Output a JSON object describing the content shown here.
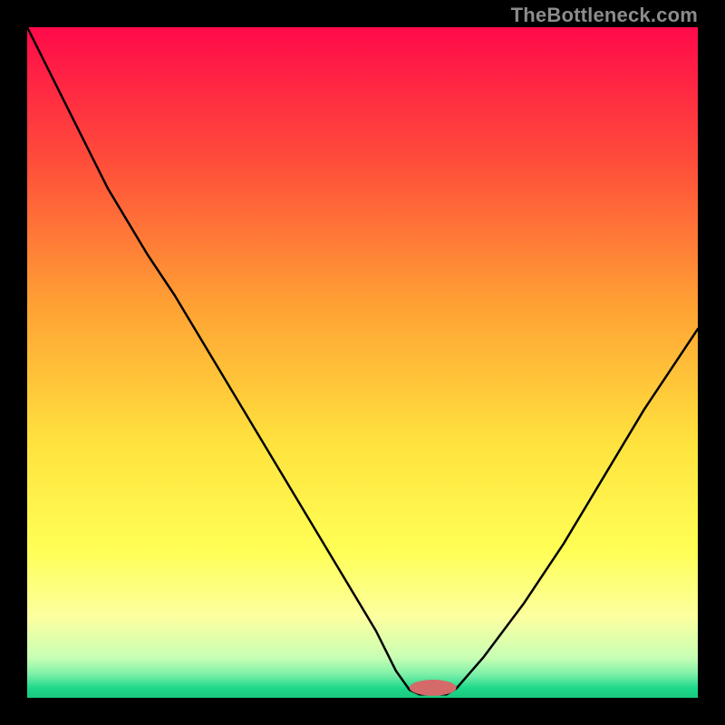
{
  "watermark": "TheBottleneck.com",
  "chart_data": {
    "type": "line",
    "title": "",
    "xlabel": "",
    "ylabel": "",
    "x_range": [
      0,
      100
    ],
    "y_range": [
      0,
      100
    ],
    "gradient_stops": [
      {
        "offset": 0.0,
        "color": "#ff0a4a"
      },
      {
        "offset": 0.2,
        "color": "#ff4d3a"
      },
      {
        "offset": 0.42,
        "color": "#ffa334"
      },
      {
        "offset": 0.62,
        "color": "#ffe23e"
      },
      {
        "offset": 0.78,
        "color": "#ffff55"
      },
      {
        "offset": 0.88,
        "color": "#fcffa0"
      },
      {
        "offset": 0.94,
        "color": "#c8ffb4"
      },
      {
        "offset": 0.965,
        "color": "#7df0a8"
      },
      {
        "offset": 0.985,
        "color": "#1fd98b"
      },
      {
        "offset": 1.0,
        "color": "#18c97e"
      }
    ],
    "series": [
      {
        "name": "bottleneck-curve",
        "color": "#000000",
        "width": 2.5,
        "points": [
          {
            "x": 0.0,
            "y": 100.0
          },
          {
            "x": 6.0,
            "y": 88.0
          },
          {
            "x": 12.0,
            "y": 76.0
          },
          {
            "x": 18.0,
            "y": 66.0
          },
          {
            "x": 22.0,
            "y": 60.0
          },
          {
            "x": 28.0,
            "y": 50.0
          },
          {
            "x": 34.0,
            "y": 40.0
          },
          {
            "x": 40.0,
            "y": 30.0
          },
          {
            "x": 46.0,
            "y": 20.0
          },
          {
            "x": 52.0,
            "y": 10.0
          },
          {
            "x": 55.0,
            "y": 4.0
          },
          {
            "x": 57.0,
            "y": 1.2
          },
          {
            "x": 58.5,
            "y": 0.5
          },
          {
            "x": 62.5,
            "y": 0.5
          },
          {
            "x": 64.0,
            "y": 1.4
          },
          {
            "x": 68.0,
            "y": 6.0
          },
          {
            "x": 74.0,
            "y": 14.0
          },
          {
            "x": 80.0,
            "y": 23.0
          },
          {
            "x": 86.0,
            "y": 33.0
          },
          {
            "x": 92.0,
            "y": 43.0
          },
          {
            "x": 100.0,
            "y": 55.0
          }
        ]
      }
    ],
    "marker": {
      "cx": 60.5,
      "cy": 1.5,
      "rx": 3.5,
      "ry": 1.2,
      "fill": "#d46a6a"
    }
  }
}
